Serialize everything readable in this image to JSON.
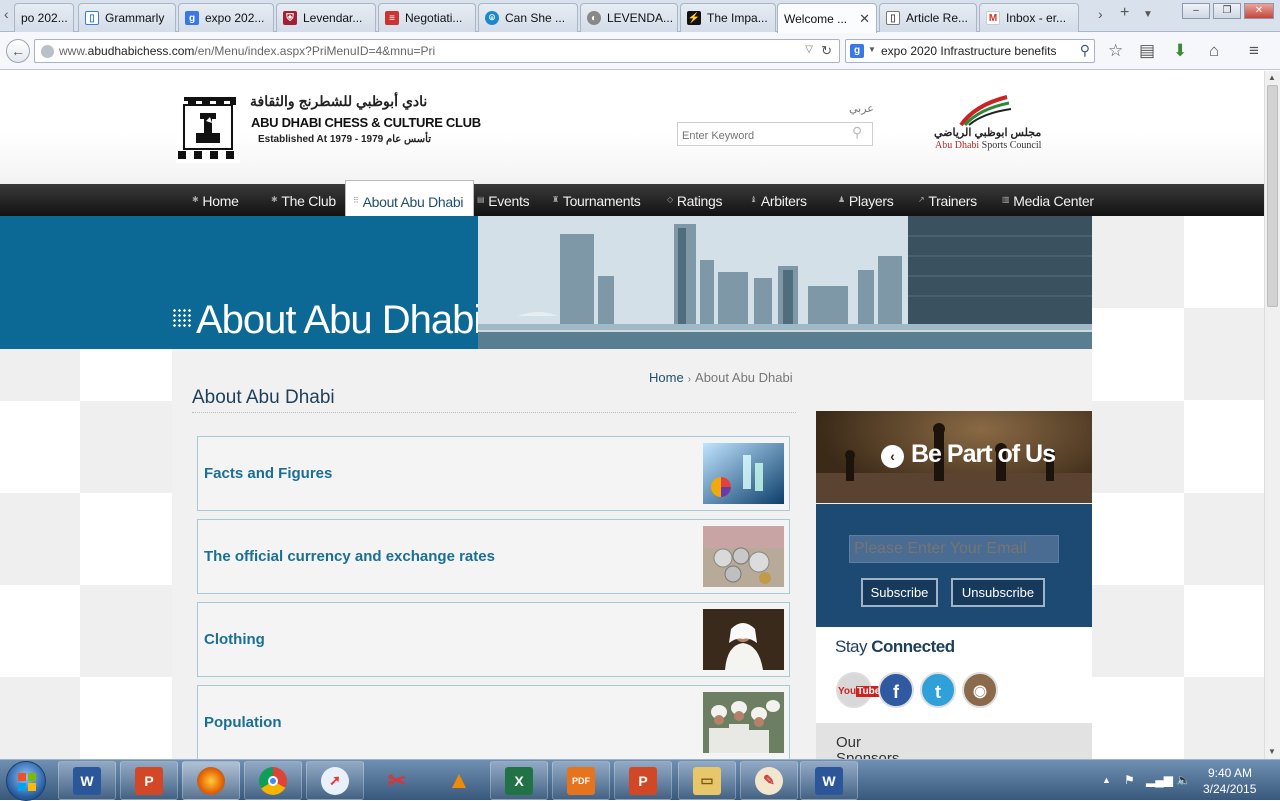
{
  "browser": {
    "tabs": [
      {
        "label": "po 202..."
      },
      {
        "label": "Grammarly"
      },
      {
        "label": "expo 202..."
      },
      {
        "label": "Levendar..."
      },
      {
        "label": "Negotiati..."
      },
      {
        "label": "Can She ..."
      },
      {
        "label": "LEVENDA..."
      },
      {
        "label": "The Impa..."
      },
      {
        "label": "Welcome ..."
      },
      {
        "label": "Article Re..."
      },
      {
        "label": "Inbox - er..."
      }
    ],
    "active_tab_index": 8,
    "url_prefix": "www.",
    "url_domain": "abudhabichess.com",
    "url_path": "/en/Menu/index.aspx?PriMenuID=4&mnu=Pri",
    "search_query": "expo 2020 Infrastructure benefits"
  },
  "site": {
    "club_name_ar": "نادي أبوظبي للشطرنج والثقافة",
    "club_name_en": "ABU DHABI CHESS & CULTURE CLUB",
    "established": "Established At 1979 - 1979 تأسس عام",
    "lang_link": "عربي",
    "search_placeholder": "Enter Keyword",
    "council_name_ar": "مجلس ابوظبي الرياضي",
    "council_name_en_a": "Abu Dhabi",
    "council_name_en_b": " Sports Council"
  },
  "menu": {
    "items": [
      {
        "label": "Home"
      },
      {
        "label": "The Club"
      },
      {
        "label": "About Abu Dhabi"
      },
      {
        "label": "Events"
      },
      {
        "label": "Tournaments"
      },
      {
        "label": "Ratings"
      },
      {
        "label": "Arbiters"
      },
      {
        "label": "Players"
      },
      {
        "label": "Trainers"
      },
      {
        "label": "Media Center"
      }
    ],
    "active_index": 2
  },
  "banner": {
    "title": "About Abu Dhabi"
  },
  "breadcrumb": {
    "home": "Home",
    "current": "About Abu Dhabi"
  },
  "main": {
    "heading": "About Abu Dhabi",
    "cards": [
      {
        "title": "Facts and Figures",
        "image": "chart-graphic"
      },
      {
        "title": "The official currency and exchange rates",
        "image": "coins-and-notes"
      },
      {
        "title": "Clothing",
        "image": "emirati-man"
      },
      {
        "title": "Population",
        "image": "crowd"
      }
    ]
  },
  "sidebar": {
    "promo_label": "Be Part of Us",
    "email_placeholder": "Please Enter Your Email",
    "subscribe_label": "Subscribe",
    "unsubscribe_label": "Unsubscribe",
    "stay_a": "Stay ",
    "stay_b": "Connected",
    "social": [
      "youtube",
      "facebook",
      "twitter",
      "instagram"
    ],
    "sponsors_label": "Our Sponsors"
  },
  "taskbar": {
    "apps": [
      "word",
      "powerpoint",
      "firefox",
      "chrome",
      "safari",
      "snipping-tool",
      "vlc",
      "excel",
      "pdf",
      "powerpoint",
      "explorer",
      "paint",
      "word"
    ],
    "time": "9:40 AM",
    "date": "3/24/2015"
  },
  "colors": {
    "accent_blue": "#0c6894",
    "link_teal": "#1b6f92",
    "sidebar_navy": "#1d4a72"
  }
}
